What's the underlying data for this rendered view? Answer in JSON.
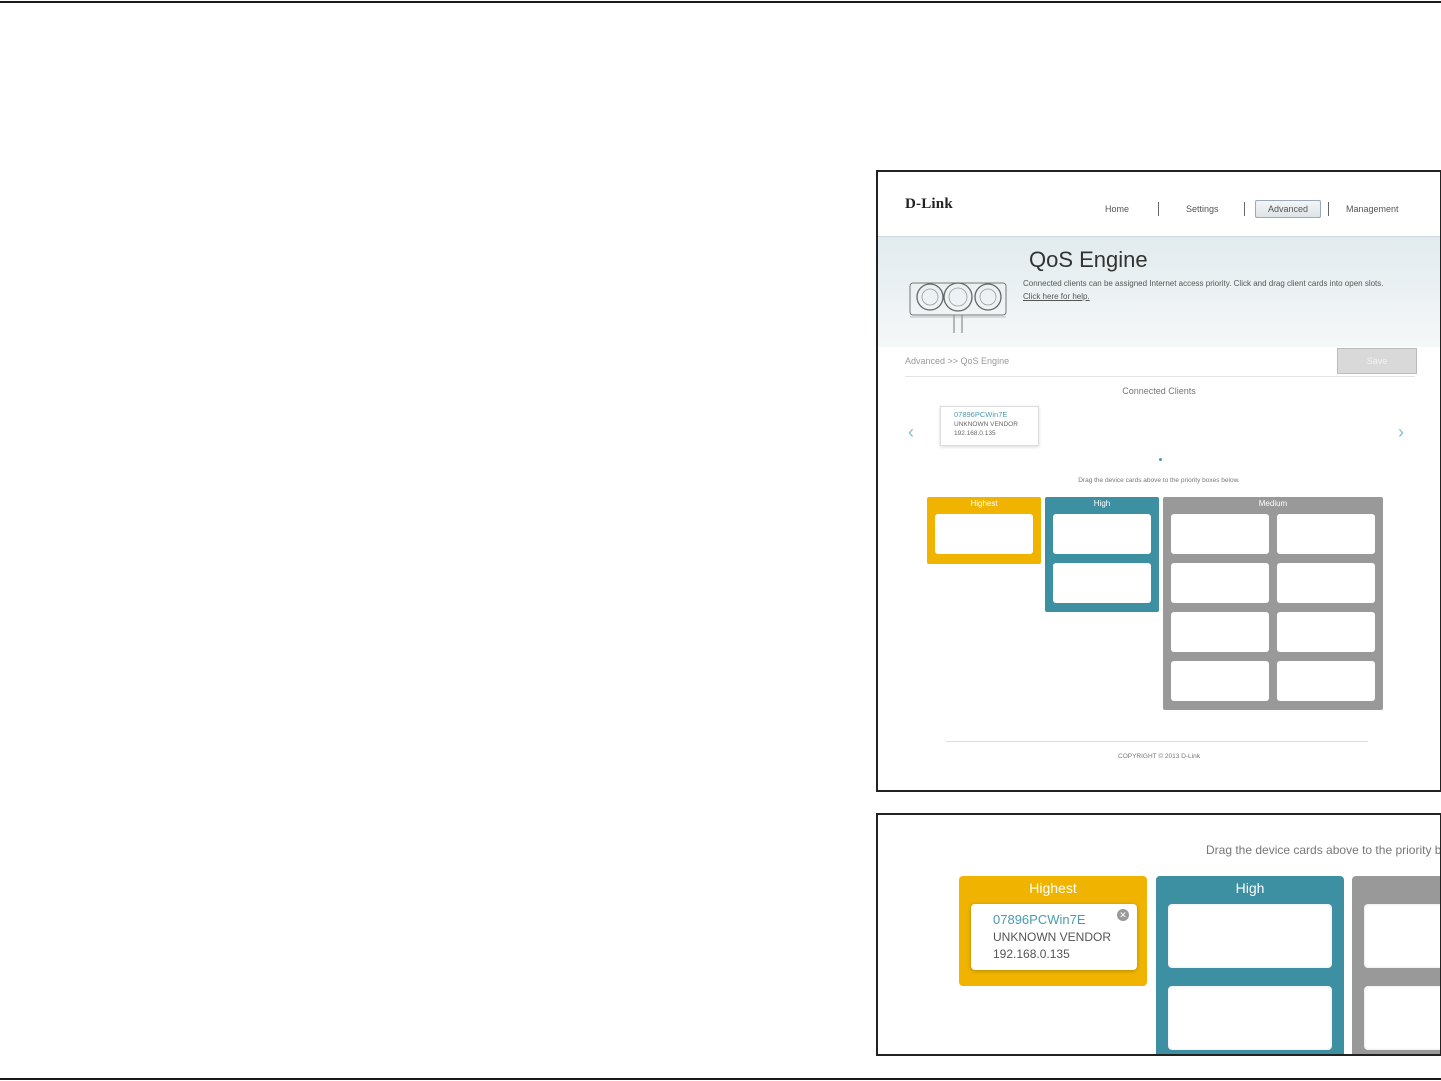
{
  "app": {
    "logo": "D-Link",
    "nav": [
      {
        "label": "Home"
      },
      {
        "label": "Settings"
      },
      {
        "label": "Advanced",
        "active": true
      },
      {
        "label": "Management"
      }
    ]
  },
  "banner": {
    "title": "QoS Engine",
    "description": "Connected clients can be assigned Internet access priority. Click and drag client cards into open slots.",
    "help_link": "Click here for help.",
    "illustration_icon": "qos-gauges-icon"
  },
  "breadcrumb": "Advanced >> QoS Engine",
  "save_label": "Save",
  "connected_clients": {
    "label": "Connected Clients",
    "prev_icon": "chevron-left-icon",
    "next_icon": "chevron-right-icon",
    "cards": [
      {
        "name": "07896PCWin7E",
        "vendor": "UNKNOWN VENDOR",
        "ip": "192.168.0.135"
      }
    ]
  },
  "drag_hint": "Drag the device cards above to the priority boxes below.",
  "priority_boxes": [
    {
      "label": "Highest",
      "color": "#f0b400",
      "slots": 1
    },
    {
      "label": "High",
      "color": "#3d8fa2",
      "slots": 2
    },
    {
      "label": "Medium",
      "color": "#999999",
      "slots": 8
    }
  ],
  "footer": {
    "copyright": "COPYRIGHT © 2013 D-Link"
  },
  "zoom": {
    "hint": "Drag the device cards above to the priority box",
    "highest_label": "Highest",
    "high_label": "High",
    "card": {
      "name": "07896PCWin7E",
      "vendor": "UNKNOWN VENDOR",
      "ip": "192.168.0.135",
      "remove_icon": "close-circle-icon"
    }
  }
}
